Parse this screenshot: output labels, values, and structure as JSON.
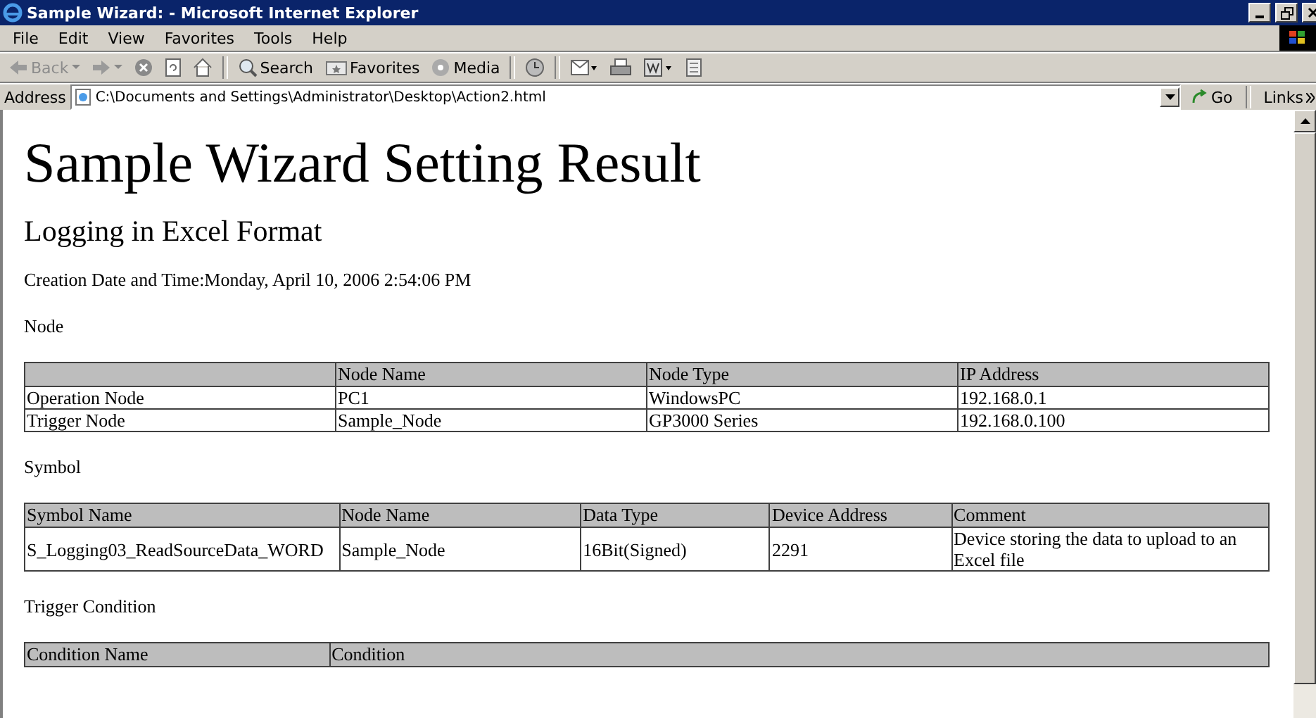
{
  "window": {
    "title": "Sample Wizard: - Microsoft Internet Explorer"
  },
  "menu": [
    "File",
    "Edit",
    "View",
    "Favorites",
    "Tools",
    "Help"
  ],
  "toolbar": [
    {
      "kind": "back",
      "label": "Back",
      "disabled": true
    },
    {
      "kind": "forward",
      "disabled": true
    },
    {
      "kind": "stop"
    },
    {
      "kind": "refresh"
    },
    {
      "kind": "home"
    },
    {
      "kind": "search",
      "label": "Search"
    },
    {
      "kind": "favorites",
      "label": "Favorites"
    },
    {
      "kind": "media",
      "label": "Media"
    },
    {
      "kind": "history"
    },
    {
      "kind": "mail"
    },
    {
      "kind": "print"
    },
    {
      "kind": "edit"
    },
    {
      "kind": "discuss"
    }
  ],
  "address": {
    "label": "Address",
    "value": "C:\\Documents and Settings\\Administrator\\Desktop\\Action2.html",
    "go": "Go",
    "links": "Links"
  },
  "document": {
    "heading": "Sample Wizard Setting Result",
    "subheading": "Logging in Excel Format",
    "created": "Creation Date and Time:Monday, April 10, 2006 2:54:06 PM",
    "sections": [
      {
        "title": "Node",
        "columns": [
          null,
          "Node Name",
          "Node Type",
          "IP Address"
        ],
        "rows": [
          [
            "Operation Node",
            "PC1",
            "WindowsPC",
            "192.168.0.1"
          ],
          [
            "Trigger Node",
            "Sample_Node",
            "GP3000 Series",
            "192.168.0.100"
          ]
        ]
      },
      {
        "title": "Symbol",
        "columns": [
          "Symbol Name",
          "Node Name",
          "Data Type",
          "Device Address",
          "Comment"
        ],
        "rows": [
          [
            "S_Logging03_ReadSourceData_WORD",
            "Sample_Node",
            "16Bit(Signed)",
            "2291",
            "Device storing the data to upload to an Excel file"
          ]
        ]
      },
      {
        "title": "Trigger Condition",
        "columns": [
          "Condition Name",
          "Condition"
        ]
      }
    ]
  }
}
